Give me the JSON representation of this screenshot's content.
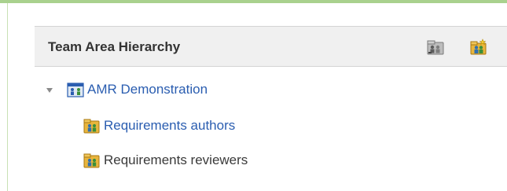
{
  "panel": {
    "title": "Team Area Hierarchy",
    "header_buttons": [
      {
        "icon": "team-area-hierarchy-icon"
      },
      {
        "icon": "new-team-area-icon"
      }
    ]
  },
  "tree": {
    "root": {
      "label": "AMR Demonstration",
      "expanded": true,
      "icon": "project-area-icon"
    },
    "children": [
      {
        "label": "Requirements authors",
        "icon": "team-area-icon"
      },
      {
        "label": "Requirements reviewers",
        "icon": "team-area-icon"
      }
    ]
  },
  "colors": {
    "link": "#2a5db0",
    "plain_text": "#3a3a3a",
    "header_bg": "#f0f0f0",
    "accent_rule": "#a9d18e"
  }
}
